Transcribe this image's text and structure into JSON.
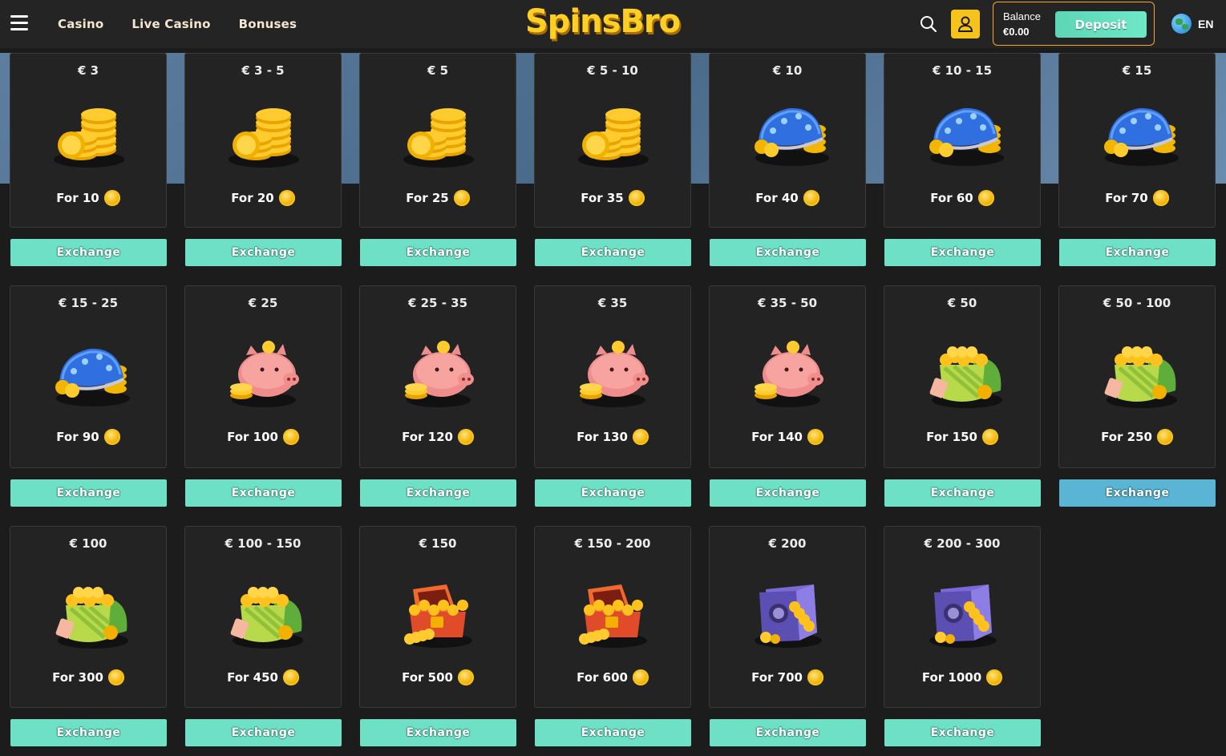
{
  "header": {
    "nav": [
      "Casino",
      "Live Casino",
      "Bonuses"
    ],
    "logo": "SpinsBro",
    "balance_label": "Balance",
    "balance_value": "€0.00",
    "deposit_label": "Deposit",
    "language": "EN",
    "icons": [
      "menu-icon",
      "search-icon",
      "user-icon",
      "globe-icon"
    ]
  },
  "exchange_label": "Exchange",
  "cards": [
    {
      "range": "€ 3",
      "price": "For 10",
      "item": "coins"
    },
    {
      "range": "€ 3 - 5",
      "price": "For 20",
      "item": "coins"
    },
    {
      "range": "€ 5",
      "price": "For 25",
      "item": "coins"
    },
    {
      "range": "€ 5 - 10",
      "price": "For 35",
      "item": "coins"
    },
    {
      "range": "€ 10",
      "price": "For 40",
      "item": "purse"
    },
    {
      "range": "€ 10 - 15",
      "price": "For 60",
      "item": "purse"
    },
    {
      "range": "€ 15",
      "price": "For 70",
      "item": "purse"
    },
    {
      "range": "€ 15 - 25",
      "price": "For 90",
      "item": "purse"
    },
    {
      "range": "€ 25",
      "price": "For 100",
      "item": "piggy"
    },
    {
      "range": "€ 25 - 35",
      "price": "For 120",
      "item": "piggy"
    },
    {
      "range": "€ 35",
      "price": "For 130",
      "item": "piggy"
    },
    {
      "range": "€ 35 - 50",
      "price": "For 140",
      "item": "piggy"
    },
    {
      "range": "€ 50",
      "price": "For 150",
      "item": "pot"
    },
    {
      "range": "€ 50 - 100",
      "price": "For 250",
      "item": "pot"
    },
    {
      "range": "€ 100",
      "price": "For 300",
      "item": "pot"
    },
    {
      "range": "€ 100 - 150",
      "price": "For 450",
      "item": "pot"
    },
    {
      "range": "€ 150",
      "price": "For 500",
      "item": "chest"
    },
    {
      "range": "€ 150 - 200",
      "price": "For 600",
      "item": "chest"
    },
    {
      "range": "€ 200",
      "price": "For 700",
      "item": "safe"
    },
    {
      "range": "€ 200 - 300",
      "price": "For 1000",
      "item": "safe"
    }
  ],
  "hovered_card_index": 13,
  "colors": {
    "accent": "#6de0c6",
    "hover": "#5ab4d3",
    "logo": "#ffcf26",
    "balance_border": "#f5a623"
  }
}
